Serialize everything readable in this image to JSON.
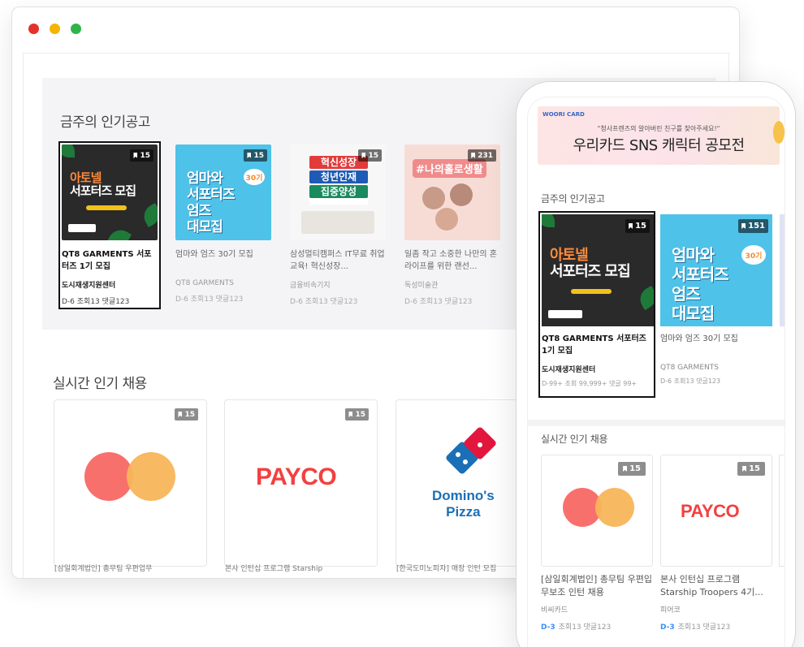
{
  "window_dots": [
    "#e5312b",
    "#f4b400",
    "#2fb44a"
  ],
  "desktop": {
    "section_title": "금주의 인기공고",
    "cards": [
      {
        "badge": "15",
        "name": "QT8 GARMENTS 서포터즈 1기 모집",
        "company": "도시재생지원센터",
        "meta": "D-6  조회13  댓글123",
        "poster": {
          "line1": "아토넬",
          "line2": "서포터즈 모집"
        }
      },
      {
        "badge": "15",
        "name": "엄마와 엄즈 30기 모집",
        "company": "QT8 GARMENTS",
        "meta": "D-6  조회13  댓글123",
        "poster": {
          "line1": "엄마와",
          "line2": "서포터즈",
          "line3": "엄즈",
          "line4": "대모집",
          "tag": "30기"
        }
      },
      {
        "badge": "15",
        "name": "삼성멀티캠퍼스 IT무료 취업교육! 혁신성장...",
        "company": "금융비속기지",
        "meta": "D-6  조회13  댓글123",
        "poster": {
          "line1": "혁신성장",
          "line2": "청년인재",
          "line3": "집중양성"
        }
      },
      {
        "badge": "231",
        "name": "일좀 작고 소중한 나만의 혼라이프를 위한 랜선...",
        "company": "독성미술관",
        "meta": "D-6  조회13  댓글123",
        "poster": {
          "line1": "#나의홀로생활"
        }
      }
    ],
    "realtime_title": "실시간 인기 채용",
    "realtime_cards": [
      {
        "badge": "15",
        "logo": "mastercard-logo",
        "caption": "[삼일회계법인] 총무팀 우편업무"
      },
      {
        "badge": "15",
        "logo": "payco-logo",
        "logo_text": "PAYCO",
        "caption": "본사 인턴십 프로그램 Starship"
      },
      {
        "badge": "15",
        "logo": "dominos-logo",
        "logo_text1": "Domino's",
        "logo_text2": "Pizza",
        "caption": "[한국도미노피자] 매장 인턴 모집"
      }
    ]
  },
  "mobile": {
    "banner": {
      "brand": "WOORI CARD",
      "sub": "\"청사프렌즈의 알아버린 친구를 찾아주세요!\"",
      "title": "우리카드 SNS 캐릭터 공모전"
    },
    "section_title": "금주의 인기공고",
    "cards": [
      {
        "badge": "15",
        "name": "QT8 GARMENTS 서포터즈 1기 모집",
        "company": "도시재생지원센터",
        "meta": "D-99+  조회 99,999+  댓글 99+",
        "poster": {
          "line1": "아토넬",
          "line2": "서포터즈 모집"
        }
      },
      {
        "badge": "151",
        "name": "엄마와 엄즈 30기 모집",
        "company": "QT8 GARMENTS",
        "meta": "D-6  조회13  댓글123",
        "poster": {
          "line1": "엄마와",
          "line2": "서포터즈",
          "line3": "엄즈",
          "line4": "대모집",
          "tag": "30기"
        }
      }
    ],
    "realtime_title": "실시간 인기 채용",
    "realtime_cards": [
      {
        "badge": "15",
        "logo": "mastercard-logo",
        "name": "[삼일회계법인] 총무팀 우편입무보조 인턴 채용",
        "company": "비씨카드",
        "dday": "D-3",
        "meta": "조회13  댓글123"
      },
      {
        "badge": "15",
        "logo": "payco-logo",
        "logo_text": "PAYCO",
        "name": "본사 인턴십 프로그램 Starship Troopers 4기...",
        "company": "피어코",
        "dday": "D-3",
        "meta": "조회13  댓글123"
      }
    ]
  }
}
